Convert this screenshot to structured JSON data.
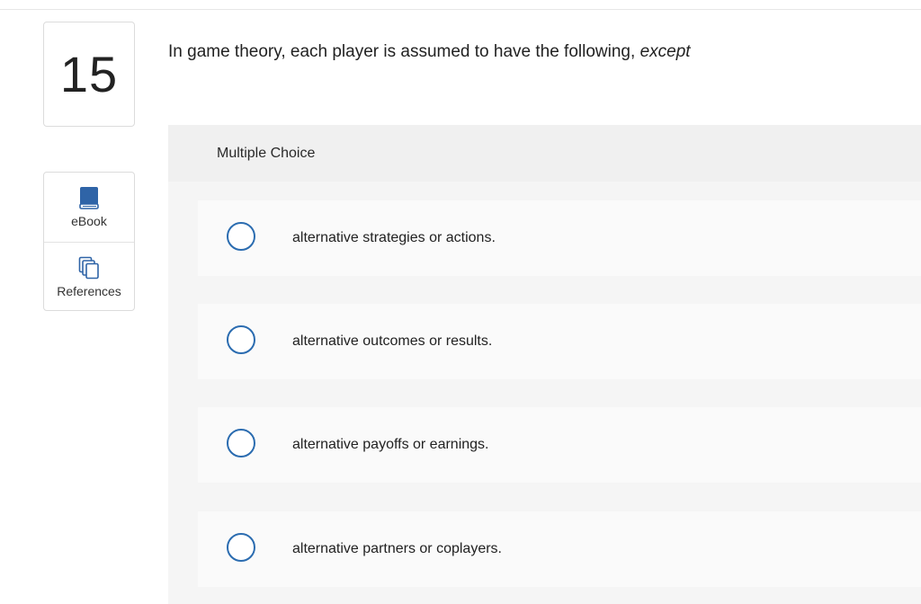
{
  "question": {
    "number": "15",
    "prompt_main": "In game theory, each player is assumed to have the following,",
    "prompt_emphasis": "except"
  },
  "tools": [
    {
      "label": "eBook",
      "icon": "book-icon"
    },
    {
      "label": "References",
      "icon": "references-icon"
    }
  ],
  "multiple_choice": {
    "header": "Multiple Choice",
    "options": [
      {
        "text": "alternative strategies or actions."
      },
      {
        "text": "alternative outcomes or results."
      },
      {
        "text": "alternative payoffs or earnings."
      },
      {
        "text": "alternative partners or coplayers."
      }
    ]
  },
  "colors": {
    "accent": "#2b6cb0",
    "panel_bg": "#f5f5f5",
    "option_bg": "#fafafa"
  }
}
